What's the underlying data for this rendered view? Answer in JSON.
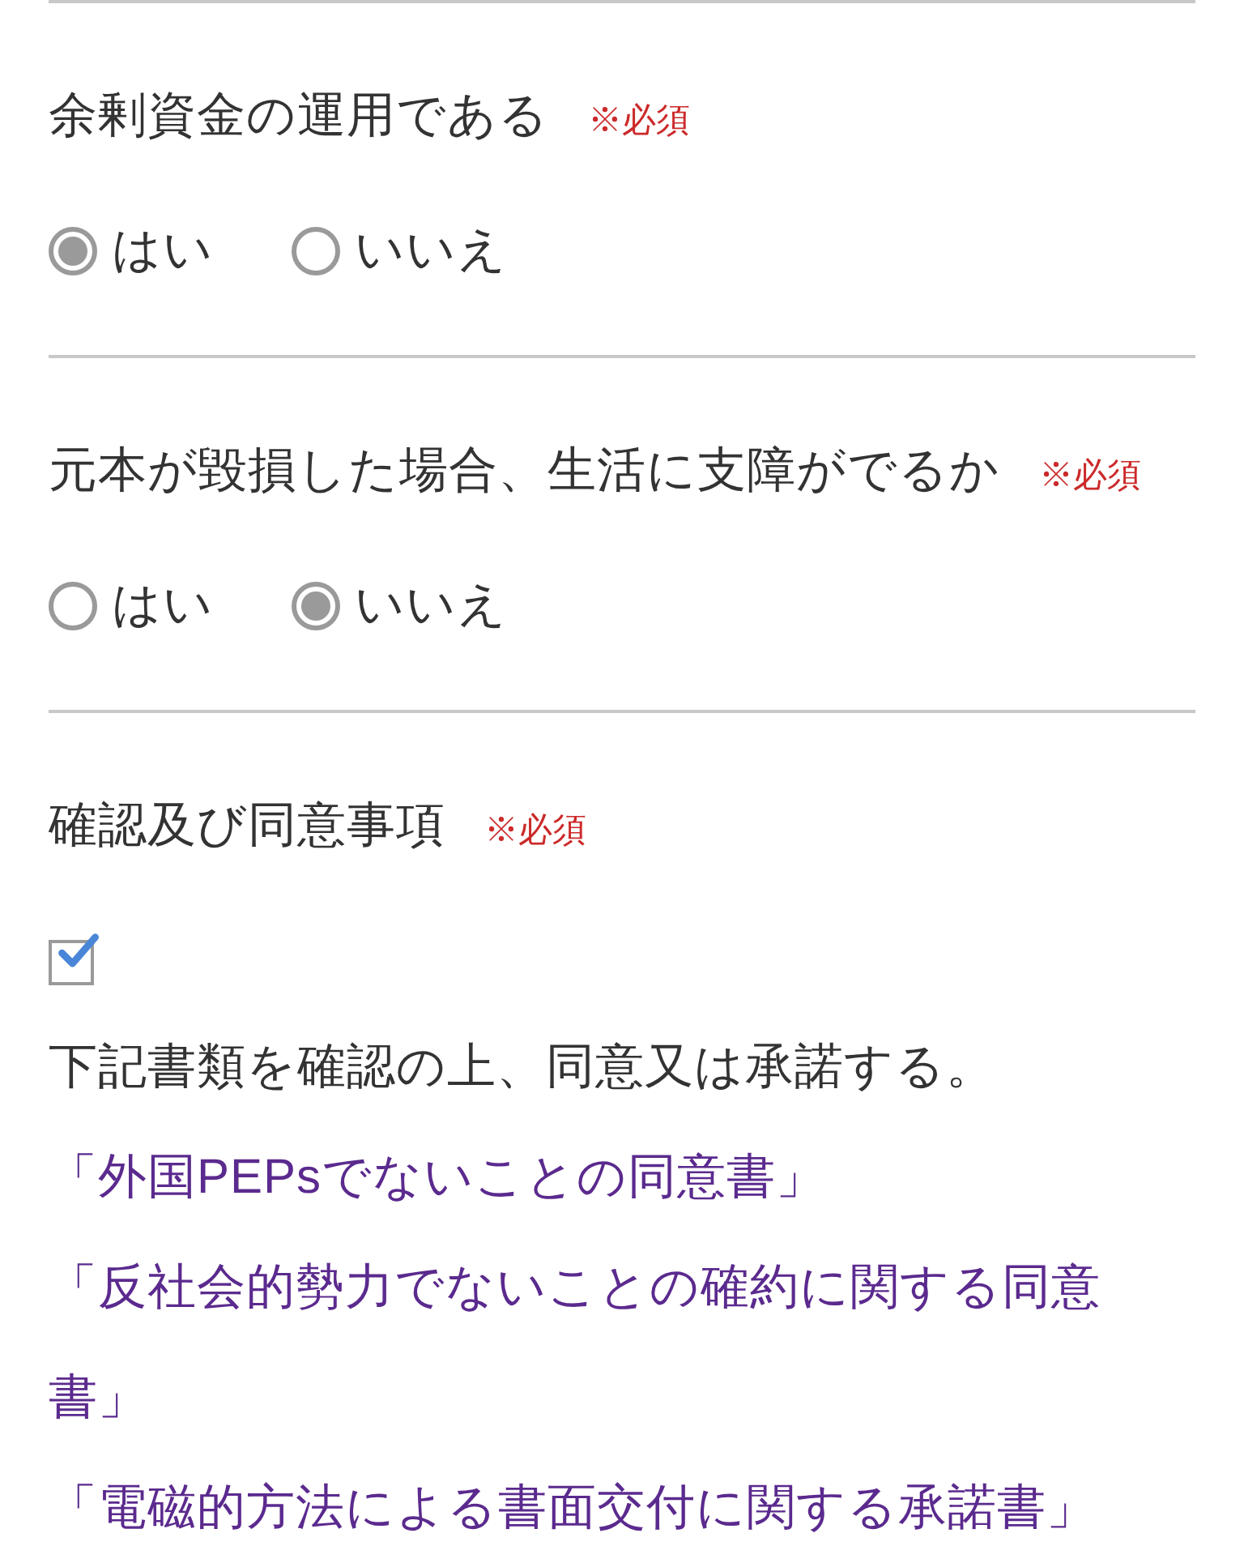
{
  "questions": [
    {
      "label": "余剰資金の運用である",
      "required": "※必須",
      "options": [
        {
          "label": "はい",
          "selected": true
        },
        {
          "label": "いいえ",
          "selected": false
        }
      ]
    },
    {
      "label": "元本が毀損した場合、生活に支障がでるか",
      "required": "※必須",
      "options": [
        {
          "label": "はい",
          "selected": false
        },
        {
          "label": "いいえ",
          "selected": true
        }
      ]
    }
  ],
  "consent": {
    "label": "確認及び同意事項",
    "required": "※必須",
    "checked": true,
    "statement": "下記書類を確認の上、同意又は承諾する。",
    "links": [
      "「外国PEPsでないことの同意書」",
      "「反社会的勢力でないことの確約に関する同意書」",
      "「電磁的方法による書面交付に関する承諾書」"
    ]
  }
}
